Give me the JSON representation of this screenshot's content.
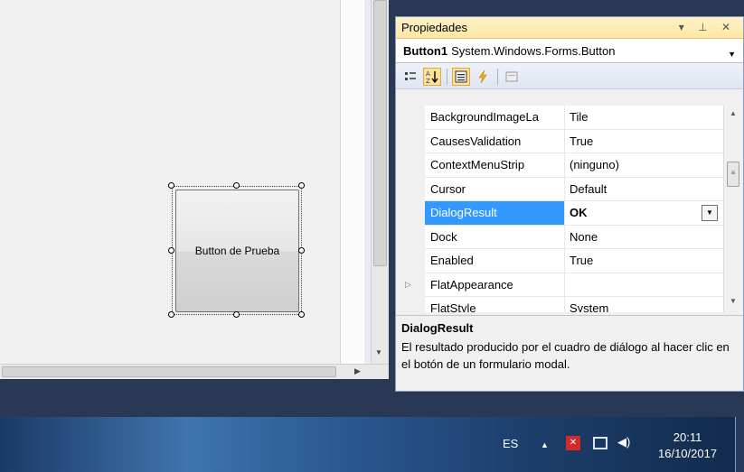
{
  "designer": {
    "form_button_label": "Button de Prueba"
  },
  "properties": {
    "title": "Propiedades",
    "title_tools": "▾ ⊥ ✕",
    "object_name": "Button1",
    "object_type": "System.Windows.Forms.Button",
    "rows": [
      {
        "name": "BackgroundImageLa",
        "value": "Tile"
      },
      {
        "name": "CausesValidation",
        "value": "True"
      },
      {
        "name": "ContextMenuStrip",
        "value": "(ninguno)"
      },
      {
        "name": "Cursor",
        "value": "Default"
      },
      {
        "name": "DialogResult",
        "value": "OK",
        "selected": true
      },
      {
        "name": "Dock",
        "value": "None"
      },
      {
        "name": "Enabled",
        "value": "True"
      },
      {
        "name": "FlatAppearance",
        "value": "",
        "expandable": true
      },
      {
        "name": "FlatStyle",
        "value": "System"
      }
    ],
    "description": {
      "title": "DialogResult",
      "text": "El resultado producido por el cuadro de diálogo al hacer clic en el botón de un formulario modal."
    }
  },
  "taskbar": {
    "language": "ES",
    "time": "20:11",
    "date": "16/10/2017"
  },
  "icons": {
    "categorized": "categorized-icon",
    "alphabetical": "sort-az-icon",
    "properties": "properties-icon",
    "events": "lightning-icon",
    "property_pages": "property-pages-icon"
  }
}
